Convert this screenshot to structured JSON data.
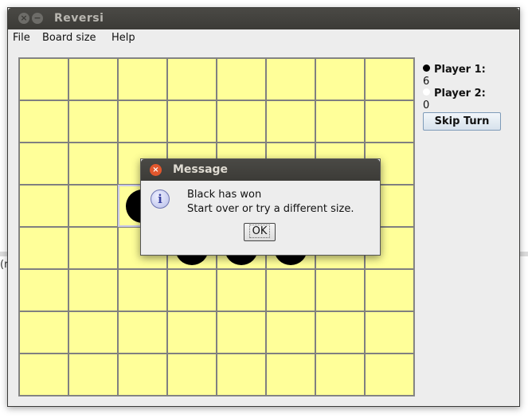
{
  "window": {
    "title": "Reversi"
  },
  "menu": [
    "File",
    "Board size",
    "Help"
  ],
  "board": {
    "rows": 8,
    "cols": 8,
    "black_discs": [
      [
        3,
        2
      ],
      [
        4,
        3
      ],
      [
        4,
        4
      ],
      [
        4,
        5
      ]
    ],
    "selected_cell": [
      3,
      2
    ]
  },
  "players": [
    {
      "label": "Player 1:",
      "score": "6",
      "dot_color": "#000000"
    },
    {
      "label": "Player 2:",
      "score": "0",
      "dot_color": "#ffffff"
    }
  ],
  "skip_button": "Skip Turn",
  "dialog": {
    "title": "Message",
    "line1": "Black has won",
    "line2": "Start over or try a different size.",
    "ok": "OK"
  },
  "colors": {
    "board": "#ffff99",
    "grid": "#808080",
    "titlebar": "#3c3b37",
    "close_button": "#e2572d"
  }
}
